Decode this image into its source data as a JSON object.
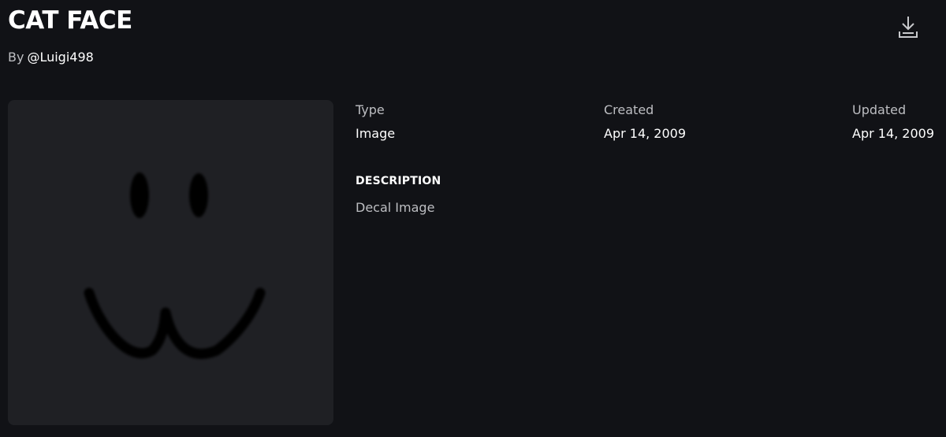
{
  "asset": {
    "title": "CAT FACE",
    "by_prefix": "By",
    "creator": "@Luigi498"
  },
  "icons": {
    "download": "download-icon"
  },
  "details": {
    "type_label": "Type",
    "type_value": "Image",
    "created_label": "Created",
    "created_value": "Apr 14, 2009",
    "updated_label": "Updated",
    "updated_value": "Apr 14, 2009"
  },
  "description": {
    "heading": "DESCRIPTION",
    "text": "Decal Image"
  },
  "colors": {
    "background": "#111216",
    "thumbnail_bg": "#1f2024",
    "muted_text": "#bdbec2",
    "text": "#ffffff"
  }
}
